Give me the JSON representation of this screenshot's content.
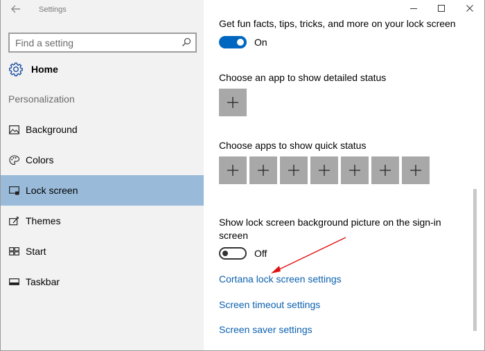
{
  "window": {
    "title": "Settings",
    "controls": [
      "minimize",
      "maximize",
      "close"
    ]
  },
  "sidebar": {
    "back_icon": "back-arrow-icon",
    "search": {
      "placeholder": "Find a setting",
      "value": "",
      "icon": "search-icon"
    },
    "home": {
      "label": "Home",
      "icon": "gear-icon"
    },
    "section": "Personalization",
    "items": [
      {
        "label": "Background",
        "icon": "background-icon",
        "selected": false
      },
      {
        "label": "Colors",
        "icon": "palette-icon",
        "selected": false
      },
      {
        "label": "Lock screen",
        "icon": "lock-screen-icon",
        "selected": true
      },
      {
        "label": "Themes",
        "icon": "themes-icon",
        "selected": false
      },
      {
        "label": "Start",
        "icon": "start-icon",
        "selected": false
      },
      {
        "label": "Taskbar",
        "icon": "taskbar-icon",
        "selected": false
      }
    ],
    "selected_color": "#99bbd9"
  },
  "content": {
    "fun_facts": {
      "label": "Get fun facts, tips, tricks, and more on your lock screen",
      "state": "On",
      "on": true
    },
    "detailed_status": {
      "label": "Choose an app to show detailed status",
      "slot_count": 1
    },
    "quick_status": {
      "label": "Choose apps to show quick status",
      "slot_count": 7
    },
    "signin_background": {
      "label_line1": "Show lock screen background picture on the sign-in",
      "label_line2": "screen",
      "state": "Off",
      "on": false
    },
    "links": {
      "cortana": "Cortana lock screen settings",
      "timeout": "Screen timeout settings",
      "saver": "Screen saver settings"
    }
  },
  "colors": {
    "accent": "#0067c0",
    "link": "#0a5fae",
    "plus_tile": "#a8a8a8",
    "annotation_arrow": "#e01010"
  }
}
